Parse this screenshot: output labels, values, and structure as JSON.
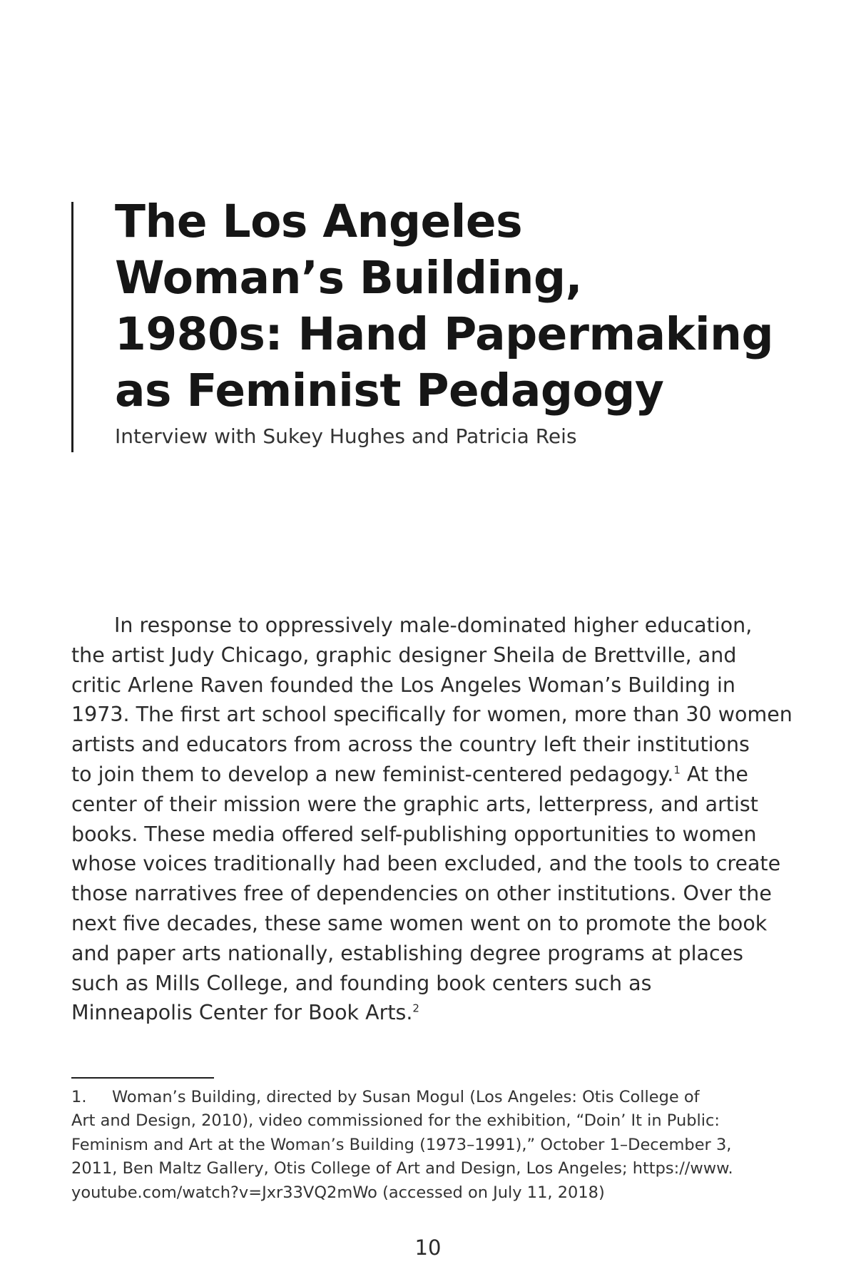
{
  "title": {
    "lines": [
      "The Los Angeles",
      "Woman’s Building,",
      "1980s: Hand Papermaking",
      "as Feminist Pedagogy"
    ],
    "subtitle": "Interview with Sukey Hughes and Patricia Reis"
  },
  "body": {
    "lines": [
      "In response to oppressively male-dominated higher education,",
      "the artist Judy Chicago, graphic designer Sheila de Brettville, and",
      "critic Arlene Raven founded the Los Angeles Woman’s Building in",
      "1973. The first art school specifically for women, more than 30 women",
      "artists and educators  from across the country left their institutions",
      "to join them to develop a new feminist-centered pedagogy.",
      "center of their mission were the graphic arts, letterpress, and artist",
      "books. These media offered self-publishing opportunities to women",
      "whose voices traditionally had been excluded, and the tools to create",
      "those narratives free of dependencies on other institutions. Over the",
      "next five decades, these same women went on to promote the book",
      "and paper arts nationally, establishing degree programs at places",
      "such as Mills College, and founding book centers such as",
      "Minneapolis  Center for Book Arts."
    ],
    "line6_sup": "1",
    "line6_tail": " At the",
    "line14_sup": "2"
  },
  "footnotes": {
    "number": "1.",
    "lines": [
      "Woman’s Building, directed by Susan Mogul (Los Angeles: Otis College of",
      "Art and Design, 2010), video commissioned for  the exhibition, “Doin’ It in Public:",
      "Feminism and Art at the Woman’s Building (1973–1991),” October 1–December 3,",
      "2011, Ben Maltz Gallery, Otis College of Art and Design, Los Angeles; https://www.",
      "youtube.com/watch?v=Jxr33VQ2mWo (accessed on July 11, 2018)"
    ]
  },
  "page_number": "10"
}
